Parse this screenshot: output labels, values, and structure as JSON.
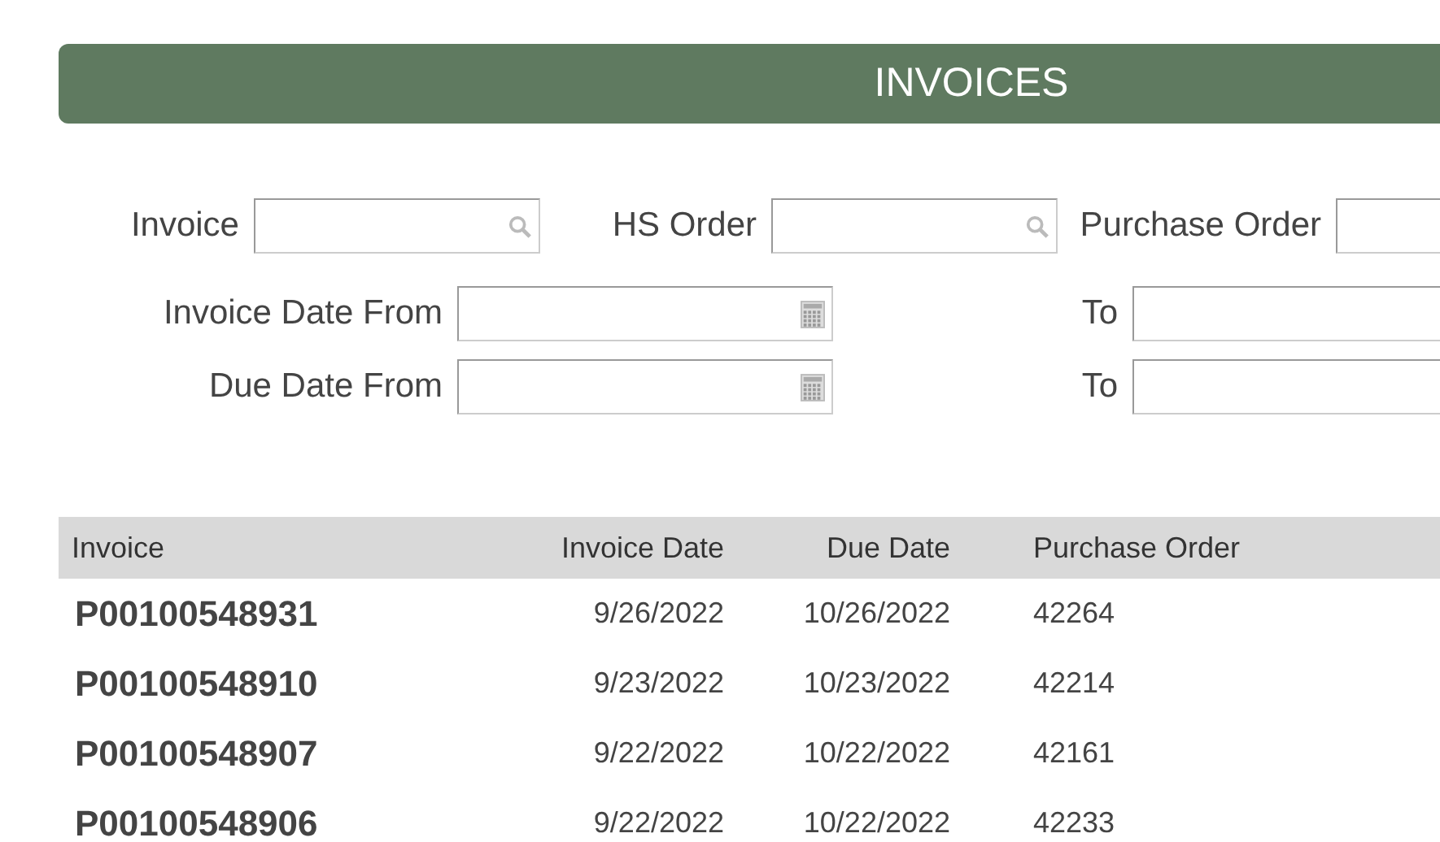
{
  "title": "INVOICES",
  "filters": [
    {
      "label": "Invoice",
      "kind": "search"
    },
    {
      "label": "HS Order",
      "kind": "search"
    },
    {
      "label": "Purchase Order",
      "kind": "text"
    },
    {
      "label": "Invoice Date From",
      "kind": "date"
    },
    {
      "label": "To",
      "kind": "text"
    },
    {
      "label": "Due Date From",
      "kind": "date"
    },
    {
      "label": "To",
      "kind": "text"
    }
  ],
  "table": {
    "columns": [
      "Invoice",
      "Invoice Date",
      "Due Date",
      "Purchase Order"
    ],
    "rows": [
      [
        "P00100548931",
        "9/26/2022",
        "10/26/2022",
        "42264"
      ],
      [
        "P00100548910",
        "9/23/2022",
        "10/23/2022",
        "42214"
      ],
      [
        "P00100548907",
        "9/22/2022",
        "10/22/2022",
        "42161"
      ],
      [
        "P00100548906",
        "9/22/2022",
        "10/22/2022",
        "42233"
      ]
    ]
  }
}
